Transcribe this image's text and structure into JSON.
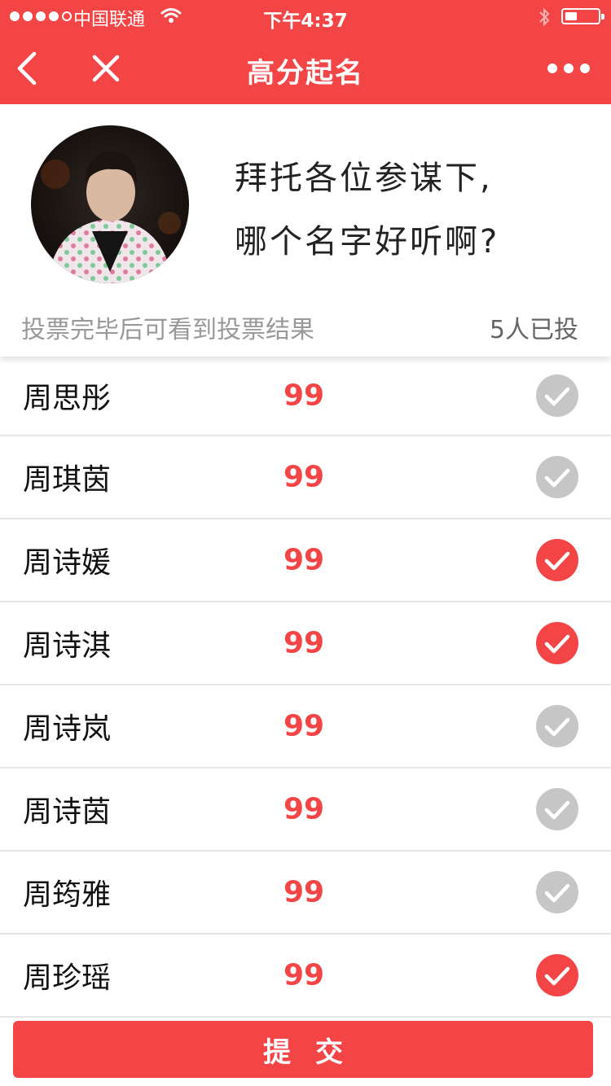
{
  "status_bar": {
    "carrier": "中国联通",
    "time": "下午4:37"
  },
  "nav": {
    "title": "高分起名",
    "back_icon": "chevron-left-icon",
    "close_icon": "close-icon",
    "more_icon": "more-dots-icon"
  },
  "profile": {
    "question_line1": "拜托各位参谋下,",
    "question_line2": "哪个名字好听啊?",
    "hint": "投票完毕后可看到投票结果",
    "vote_count": "5人已投"
  },
  "candidates": [
    {
      "name": "周思彤",
      "score": "99",
      "selected": false
    },
    {
      "name": "周琪茵",
      "score": "99",
      "selected": false
    },
    {
      "name": "周诗媛",
      "score": "99",
      "selected": true
    },
    {
      "name": "周诗淇",
      "score": "99",
      "selected": true
    },
    {
      "name": "周诗岚",
      "score": "99",
      "selected": false
    },
    {
      "name": "周诗茵",
      "score": "99",
      "selected": false
    },
    {
      "name": "周筠雅",
      "score": "99",
      "selected": false
    },
    {
      "name": "周珍瑶",
      "score": "99",
      "selected": true
    }
  ],
  "submit_label": "提交",
  "colors": {
    "accent": "#f44546",
    "unchecked": "#c6c6c6"
  }
}
